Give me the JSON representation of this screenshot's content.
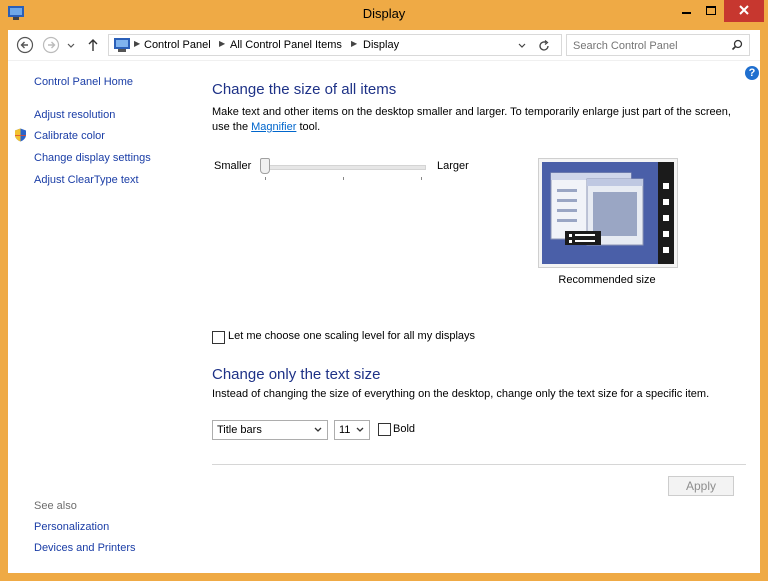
{
  "window": {
    "title": "Display"
  },
  "nav": {
    "breadcrumbs": [
      "Control Panel",
      "All Control Panel Items",
      "Display"
    ],
    "search_placeholder": "Search Control Panel"
  },
  "sidebar": {
    "home": "Control Panel Home",
    "links": [
      "Adjust resolution",
      "Calibrate color",
      "Change display settings",
      "Adjust ClearType text"
    ],
    "see_also": "See also",
    "see_also_links": [
      "Personalization",
      "Devices and Printers"
    ]
  },
  "main": {
    "heading1": "Change the size of all items",
    "desc1_part1": "Make text and other items on the desktop smaller and larger. To temporarily enlarge just part of the screen,",
    "desc1_part2_pre": "use the ",
    "desc1_link": "Magnifier",
    "desc1_part2_post": " tool.",
    "slider_min_label": "Smaller",
    "slider_max_label": "Larger",
    "slider_value": 0,
    "preview_caption": "Recommended size",
    "scaling_checkbox_label": "Let me choose one scaling level for all my displays",
    "scaling_checked": false,
    "heading2": "Change only the text size",
    "desc2": "Instead of changing the size of everything on the desktop, change only the text size for a specific item.",
    "item_select_value": "Title bars",
    "size_select_value": "11",
    "bold_label": "Bold",
    "bold_checked": false,
    "apply_label": "Apply"
  },
  "colors": {
    "window_frame": "#efaa45",
    "link_blue": "#1a3da6",
    "heading_blue": "#1e3287",
    "close_red": "#c7372f"
  }
}
